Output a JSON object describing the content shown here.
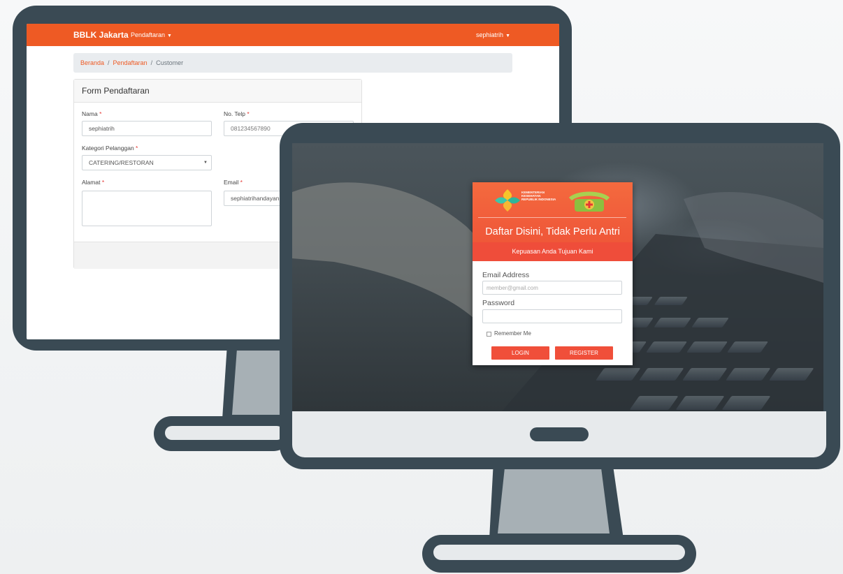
{
  "back_app": {
    "brand": "BBLK Jakarta",
    "nav_menu": "Pendaftaran",
    "user_menu": "sephiatrih",
    "breadcrumb": {
      "home": "Beranda",
      "section": "Pendaftaran",
      "current": "Customer",
      "separator": "/"
    },
    "form": {
      "title": "Form Pendaftaran",
      "required_mark": "*",
      "nama": {
        "label": "Nama",
        "value": "sephiatrih"
      },
      "telp": {
        "label": "No. Telp",
        "value": "081234567890"
      },
      "kategori": {
        "label": "Kategori Pelanggan",
        "value": "CATERING/RESTORAN"
      },
      "alamat": {
        "label": "Alamat",
        "value": ""
      },
      "email": {
        "label": "Email",
        "value": "sephiatrihandayani"
      }
    }
  },
  "login_app": {
    "logo_text": "KEMENTERIAN KESEHATAN REPUBLIK INDONESIA",
    "title": "Daftar Disini, Tidak Perlu Antri",
    "subtitle": "Kepuasan Anda Tujuan Kami",
    "email_label": "Email Address",
    "email_placeholder": "member@gmail.com",
    "password_label": "Password",
    "remember_label": "Remember Me",
    "login_button": "LOGIN",
    "register_button": "REGISTER"
  },
  "colors": {
    "brand_orange": "#ee5a24",
    "login_red": "#f04f3a",
    "monitor_frame": "#3a4a54"
  }
}
